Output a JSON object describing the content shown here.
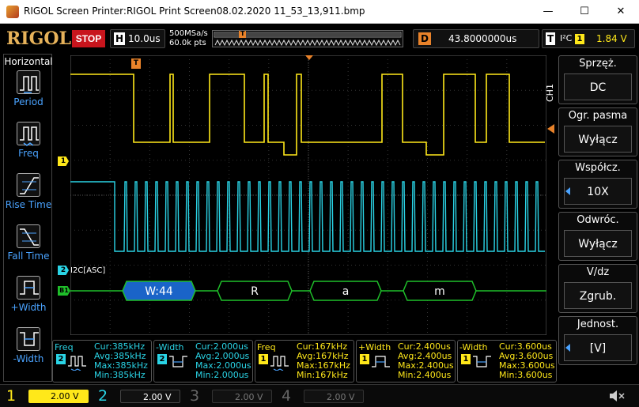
{
  "titlebar": {
    "title": "RIGOL Screen Printer:RIGOL Print Screen08.02.2020 11_53_13,911.bmp",
    "minimize": "—",
    "maximize": "☐",
    "close": "✕"
  },
  "top": {
    "logo": "RIGOL",
    "run_state": "STOP",
    "timebase_label": "H",
    "timebase_value": "10.0us",
    "sample_rate": "500MSa/s",
    "mem_depth": "60.0k pts",
    "trigger_marker": "T",
    "delay_label": "D",
    "delay_value": "43.8000000us",
    "trig_label": "T",
    "trig_protocol": "I²C",
    "trig_source": "1",
    "trig_level": "1.84 V"
  },
  "left_menu": {
    "title": "Horizontal",
    "items": [
      {
        "label": "Period"
      },
      {
        "label": "Freq"
      },
      {
        "label": "Rise Time"
      },
      {
        "label": "Fall Time"
      },
      {
        "label": "+Width"
      },
      {
        "label": "-Width"
      }
    ]
  },
  "right_menu": {
    "tab": "CH1",
    "items": [
      {
        "label": "Sprzęż.",
        "value": "DC",
        "has_arrow": false
      },
      {
        "label": "Ogr. pasma",
        "value": "Wyłącz",
        "has_arrow": false
      },
      {
        "label": "Współcz.",
        "value": "10X",
        "has_arrow": true
      },
      {
        "label": "Odwróc.",
        "value": "Wyłącz",
        "has_arrow": false
      },
      {
        "label": "V/dz",
        "value": "Zgrub.",
        "has_arrow": false
      },
      {
        "label": "Jednost.",
        "value": "[V]",
        "has_arrow": true
      }
    ]
  },
  "waveform": {
    "ch1_marker": "1",
    "ch2_marker": "2",
    "decode_marker": "B1",
    "decode_label": "I2C[ASC]",
    "trigger_marker": "T",
    "decode_frames": [
      {
        "text": "W:44",
        "highlight": true
      },
      {
        "text": "R",
        "highlight": false
      },
      {
        "text": "a",
        "highlight": false
      },
      {
        "text": "m",
        "highlight": false
      }
    ]
  },
  "measurements": [
    {
      "name": "Freq",
      "channel": "2",
      "cur": "Cur:385kHz",
      "avg": "Avg:385kHz",
      "max": "Max:385kHz",
      "min": "Min:385kHz"
    },
    {
      "name": "-Width",
      "channel": "2",
      "cur": "Cur:2.000us",
      "avg": "Avg:2.000us",
      "max": "Max:2.000us",
      "min": "Min:2.000us"
    },
    {
      "name": "Freq",
      "channel": "1",
      "cur": "Cur:167kHz",
      "avg": "Avg:167kHz",
      "max": "Max:167kHz",
      "min": "Min:167kHz"
    },
    {
      "name": "+Width",
      "channel": "1",
      "cur": "Cur:2.400us",
      "avg": "Avg:2.400us",
      "max": "Max:2.400us",
      "min": "Min:2.400us"
    },
    {
      "name": "-Width",
      "channel": "1",
      "cur": "Cur:3.600us",
      "avg": "Avg:3.600us",
      "max": "Max:3.600us",
      "min": "Min:3.600us"
    }
  ],
  "channels": [
    {
      "num": "1",
      "scale": "2.00 V",
      "active": true
    },
    {
      "num": "2",
      "scale": "2.00 V",
      "active": true
    },
    {
      "num": "3",
      "scale": "2.00 V",
      "active": false
    },
    {
      "num": "4",
      "scale": "2.00 V",
      "active": false
    }
  ],
  "colors": {
    "ch1": "#ffe81a",
    "ch2": "#2ad4e6",
    "decode": "#1fbf2a",
    "trigger": "#e8822a",
    "accent_blue": "#4aa3ff"
  }
}
